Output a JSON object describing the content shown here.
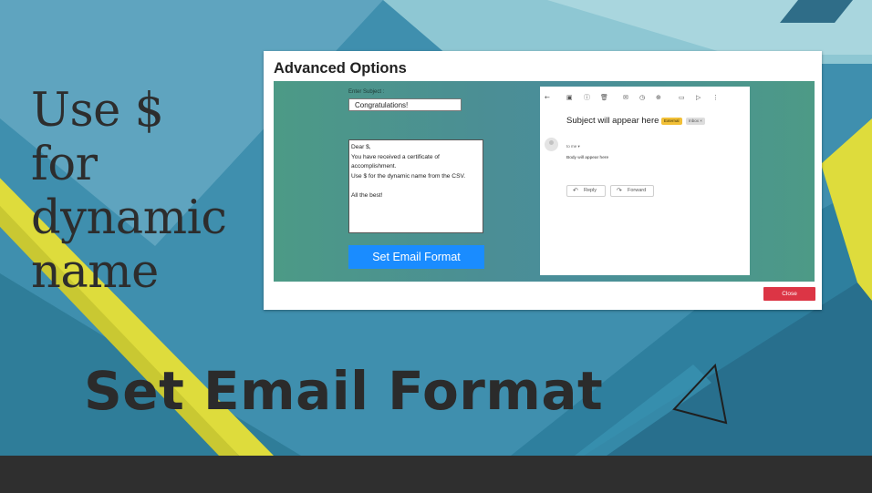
{
  "colors": {
    "background_teal": "#3f8fae",
    "accent_yellow": "#dedc3c",
    "dark_text": "#2b2b2b",
    "primary_button": "#1a8cff",
    "close_button": "#dc3545"
  },
  "side_text": [
    "Use $",
    "for",
    "dynamic",
    "name"
  ],
  "big_title": "Set Email Format",
  "dialog": {
    "title": "Advanced Options",
    "subject_label": "Enter Subject :",
    "subject_value": "Congratulations!",
    "body_lines": [
      "Dear $,",
      "You have received a certificate of",
      "accomplishment.",
      "Use $ for the dynamic name from the CSV.",
      "",
      "All the best!"
    ],
    "set_button_label": "Set Email Format",
    "close_label": "Close"
  },
  "preview": {
    "toolbar_icons": [
      "back-icon",
      "archive-icon",
      "report-icon",
      "delete-icon",
      "mail-icon",
      "snooze-icon",
      "add-task-icon",
      "move-icon",
      "label-icon",
      "more-icon"
    ],
    "subject": "Subject will appear here",
    "tag_external": "External",
    "tag_inbox": "Inbox ×",
    "to_me": "to me ▾",
    "body": "Body will appear here",
    "reply_label": "Reply",
    "forward_label": "Forward"
  }
}
